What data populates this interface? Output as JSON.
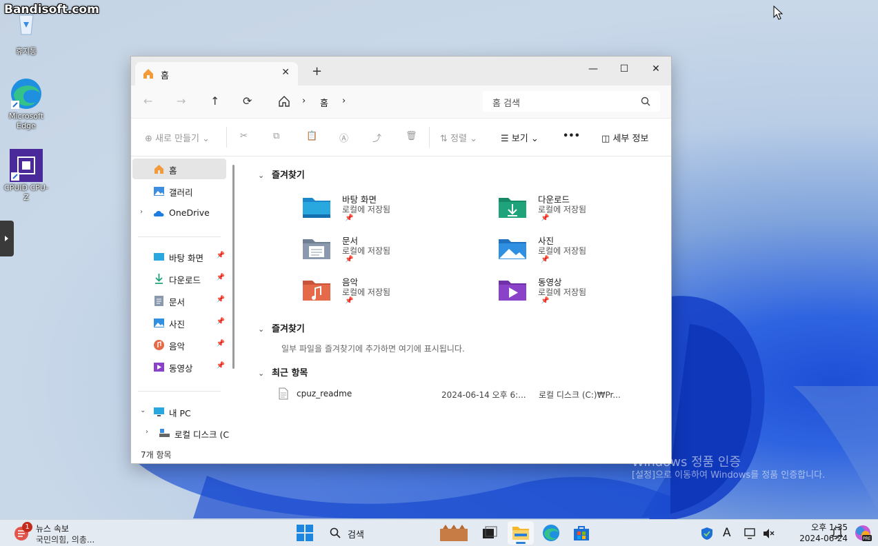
{
  "watermark_brand": "Bandisoft.com",
  "desktop": {
    "icons": [
      {
        "label": "휴지통"
      },
      {
        "label": "Microsoft Edge"
      },
      {
        "label": "CPUID CPU-Z"
      }
    ],
    "activation": {
      "title": "Windows 정품 인증",
      "body": "[설정]으로 이동하여 Windows를 정품 인증합니다."
    }
  },
  "window": {
    "tab_label": "홈",
    "tab_close": "✕",
    "new_tab": "+",
    "controls": {
      "minimize": "—",
      "maximize": "☐",
      "close": "✕"
    },
    "nav": {
      "back": "←",
      "forward": "→",
      "up": "↑",
      "refresh": "⟳",
      "breadcrumb_sep": "›",
      "breadcrumb_current": "홈",
      "breadcrumb_trailing": "›"
    },
    "search_placeholder": "홈 검색",
    "toolbar": {
      "new": "새로 만들기",
      "sort": "정렬",
      "view": "보기",
      "more": "•••",
      "details": "세부 정보"
    },
    "sidebar": {
      "top": [
        {
          "label": "홈"
        },
        {
          "label": "갤러리"
        },
        {
          "label": "OneDrive"
        }
      ],
      "pinned": [
        {
          "label": "바탕 화면"
        },
        {
          "label": "다운로드"
        },
        {
          "label": "문서"
        },
        {
          "label": "사진"
        },
        {
          "label": "음악"
        },
        {
          "label": "동영상"
        }
      ],
      "pc": [
        {
          "label": "내 PC"
        },
        {
          "label": "로컬 디스크 (C"
        }
      ]
    },
    "content": {
      "section1": "즐겨찾기",
      "quick_access": [
        {
          "name": "바탕 화면",
          "sub": "로컬에 저장됨",
          "color": "#29a8e0"
        },
        {
          "name": "다운로드",
          "sub": "로컬에 저장됨",
          "color": "#1fa37a"
        },
        {
          "name": "문서",
          "sub": "로컬에 저장됨",
          "color": "#8a99ad"
        },
        {
          "name": "사진",
          "sub": "로컬에 저장됨",
          "color": "#2f8fe0"
        },
        {
          "name": "음악",
          "sub": "로컬에 저장됨",
          "color": "#e46a4a"
        },
        {
          "name": "동영상",
          "sub": "로컬에 저장됨",
          "color": "#8a43c8"
        }
      ],
      "section2": "즐겨찾기",
      "section2_empty": "일부 파일을 즐겨찾기에 추가하면 여기에 표시됩니다.",
      "section3": "최근 항목",
      "recent": [
        {
          "name": "cpuz_readme",
          "date": "2024-06-14 오후 6:...",
          "location": "로컬 디스크 (C:)₩Pr..."
        }
      ]
    },
    "status": "7개 항목"
  },
  "taskbar": {
    "news_badge": "1",
    "news_title": "뉴스 속보",
    "news_sub": "국민의힘, 의총...",
    "search": "검색",
    "ime": "A",
    "clock_time": "오후 1:35",
    "clock_date": "2024-06-24"
  }
}
